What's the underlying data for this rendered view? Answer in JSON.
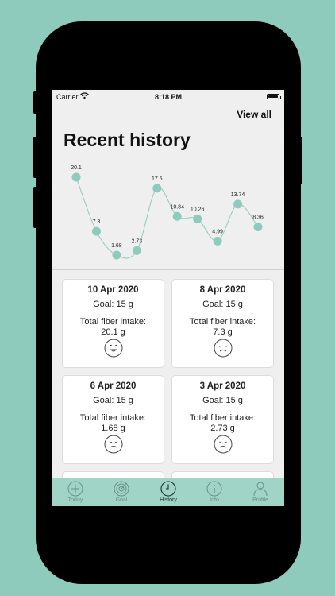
{
  "status": {
    "carrier": "Carrier",
    "time": "8:18 PM"
  },
  "header": {
    "view_all": "View all",
    "title": "Recent history"
  },
  "chart_data": {
    "type": "line",
    "values": [
      20.1,
      7.3,
      1.68,
      2.73,
      17.5,
      10.84,
      10.26,
      4.99,
      13.74,
      8.36
    ],
    "labels": [
      "20.1",
      "7.3",
      "1.68",
      "2.73",
      "17.5",
      "10.84",
      "10.26",
      "4.99",
      "13.74",
      "8.36"
    ],
    "point_color": "#8fcbbc",
    "line_color": "#8fcbbc",
    "grid": false
  },
  "cards": [
    {
      "date": "10 Apr 2020",
      "goal": "Goal: 15 g",
      "intake_label": "Total fiber intake:",
      "intake_value": "20.1 g",
      "mood": "happy"
    },
    {
      "date": "8 Apr 2020",
      "goal": "Goal: 15 g",
      "intake_label": "Total fiber intake:",
      "intake_value": "7.3 g",
      "mood": "sad"
    },
    {
      "date": "6 Apr 2020",
      "goal": "Goal: 15 g",
      "intake_label": "Total fiber intake:",
      "intake_value": "1.68 g",
      "mood": "sad"
    },
    {
      "date": "3 Apr 2020",
      "goal": "Goal: 15 g",
      "intake_label": "Total fiber intake:",
      "intake_value": "2.73 g",
      "mood": "sad"
    }
  ],
  "tabs": [
    {
      "label": "Today",
      "icon": "plus-circle-icon"
    },
    {
      "label": "Goal",
      "icon": "target-icon"
    },
    {
      "label": "History",
      "icon": "clock-icon",
      "active": true
    },
    {
      "label": "Info",
      "icon": "info-icon"
    },
    {
      "label": "Profile",
      "icon": "person-icon"
    }
  ],
  "colors": {
    "background": "#8fcbbc",
    "tabbar": "#9fd4c6",
    "accent": "#8fcbbc"
  }
}
